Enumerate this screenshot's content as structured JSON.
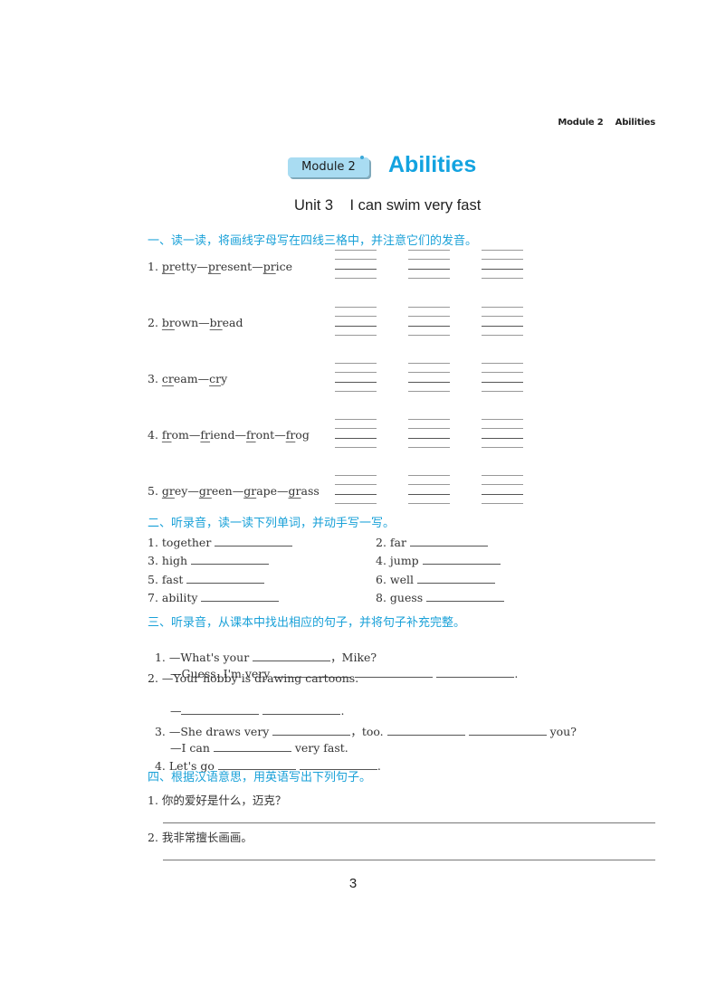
{
  "running_header": "Module 2    Abilities",
  "module_badge": "Module 2",
  "module_title": "Abilities",
  "unit_title": "Unit 3    I can swim very fast",
  "sections": {
    "s1": {
      "heading": "一、读一读，将画线字母写在四线三格中，并注意它们的发音。",
      "items": [
        {
          "num": "1.",
          "words": [
            "pretty",
            "present",
            "price"
          ],
          "underlined": [
            "pr",
            "pr",
            "pr"
          ]
        },
        {
          "num": "2.",
          "words": [
            "brown",
            "bread"
          ],
          "underlined": [
            "br",
            "br"
          ]
        },
        {
          "num": "3.",
          "words": [
            "cream",
            "cry"
          ],
          "underlined": [
            "cr",
            "cr"
          ]
        },
        {
          "num": "4.",
          "words": [
            "from",
            "friend",
            "front",
            "frog"
          ],
          "underlined": [
            "fr",
            "fr",
            "fr",
            "fr"
          ]
        },
        {
          "num": "5.",
          "words": [
            "grey",
            "green",
            "grape",
            "grass"
          ],
          "underlined": [
            "gr",
            "gr",
            "gr",
            "gr"
          ]
        }
      ]
    },
    "s2": {
      "heading": "二、听录音，读一读下列单词，并动手写一写。",
      "items": [
        {
          "label": "1. together"
        },
        {
          "label": "2. far"
        },
        {
          "label": "3. high"
        },
        {
          "label": "4. jump"
        },
        {
          "label": "5. fast"
        },
        {
          "label": "6. well"
        },
        {
          "label": "7. ability"
        },
        {
          "label": "8. guess"
        }
      ]
    },
    "s3": {
      "heading": "三、听录音，从课本中找出相应的句子，并将句子补充完整。",
      "q1a_pre": "1. —What's your ",
      "q1a_post": "，Mike?",
      "q1b_pre": "—Guess. I'm very ",
      "q1b_post": ".",
      "q2a": "2. —Your hobby is drawing cartoons.",
      "q2b_pre": "—",
      "q2b_post": ".",
      "q3a_pre": "3. —She draws very ",
      "q3a_mid": "，too. ",
      "q3a_post": " you?",
      "q3b_pre": "—I can ",
      "q3b_post": " very fast.",
      "q4_pre": "4. Let's go ",
      "q4_post": "."
    },
    "s4": {
      "heading": "四、根据汉语意思，用英语写出下列句子。",
      "items": [
        {
          "label": "1. 你的爱好是什么，迈克？"
        },
        {
          "label": "2. 我非常擅长画画。"
        }
      ]
    }
  },
  "page_number": "3",
  "colors": {
    "accent": "#1aa1d8",
    "title": "#13a3e0",
    "badge": "#a9dcf2"
  }
}
